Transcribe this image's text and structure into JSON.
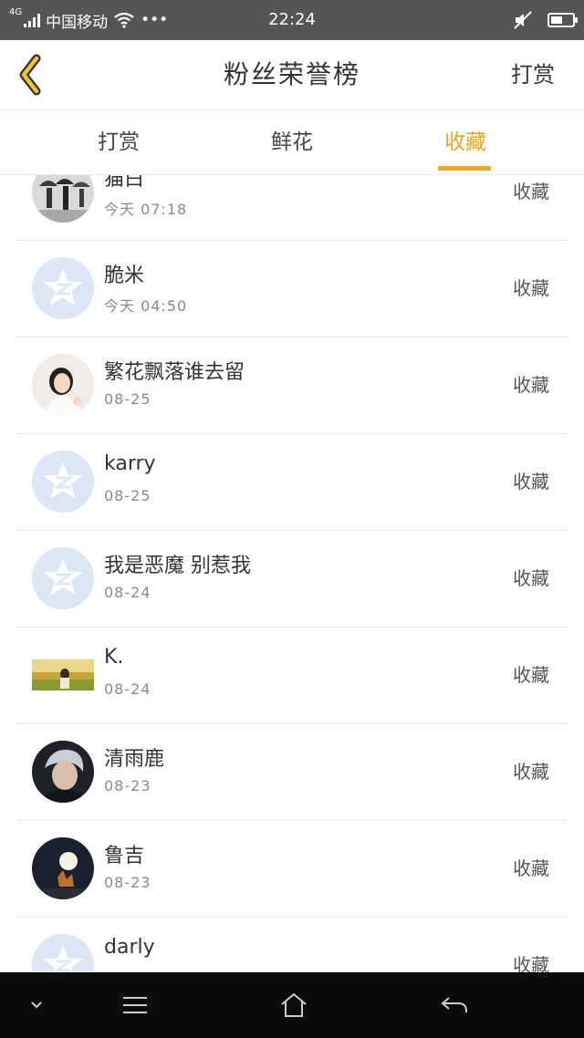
{
  "status_bar": {
    "network": "4G",
    "carrier": "中国移动",
    "more": "•••",
    "time": "22:24",
    "battery_level": 0.55,
    "icons": [
      "signal-icon",
      "wifi-icon",
      "mute-icon",
      "battery-icon"
    ]
  },
  "header": {
    "title": "粉丝荣誉榜",
    "right_action": "打赏",
    "back_icon": "chevron-left-icon"
  },
  "tabs": [
    {
      "label": "打赏",
      "active": false
    },
    {
      "label": "鲜花",
      "active": false
    },
    {
      "label": "收藏",
      "active": true
    }
  ],
  "list": [
    {
      "name": "猫白",
      "time": "今天 07:18",
      "action": "收藏",
      "avatar": "photo-umbrellas"
    },
    {
      "name": "脆米",
      "time": "今天 04:50",
      "action": "收藏",
      "avatar": "qzone-default"
    },
    {
      "name": "繁花飘落谁去留",
      "time": "08-25",
      "action": "收藏",
      "avatar": "photo-girl"
    },
    {
      "name": "karry",
      "time": "08-25",
      "action": "收藏",
      "avatar": "qzone-default"
    },
    {
      "name": "我是恶魔 别惹我",
      "time": "08-24",
      "action": "收藏",
      "avatar": "qzone-default"
    },
    {
      "name": "K.",
      "time": "08-24",
      "action": "收藏",
      "avatar": "photo-field"
    },
    {
      "name": "清雨鹿",
      "time": "08-23",
      "action": "收藏",
      "avatar": "photo-boy"
    },
    {
      "name": "鲁吉",
      "time": "08-23",
      "action": "收藏",
      "avatar": "photo-moon"
    },
    {
      "name": "darly",
      "time": "",
      "action": "收藏",
      "avatar": "qzone-default"
    }
  ],
  "nav_bar": {
    "icons": [
      "chevron-down-icon",
      "menu-icon",
      "home-icon",
      "back-icon"
    ]
  },
  "colors": {
    "accent": "#f0a81c",
    "status_bar": "#555555",
    "nav_bar": "#0b0b0b",
    "divider": "#e6e6e6",
    "default_avatar": "#dbe7f4"
  }
}
